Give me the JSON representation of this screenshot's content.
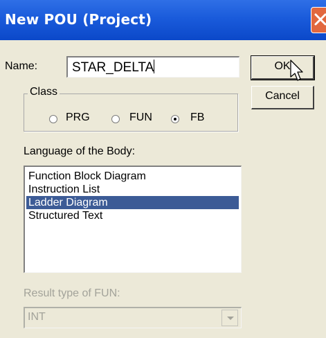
{
  "window": {
    "title": "New POU (Project)",
    "close_icon": "close-icon",
    "titlebar_color": "#0b48c9",
    "close_color": "#e2683e"
  },
  "name_field": {
    "label": "Name:",
    "value": "STAR_DELTA"
  },
  "buttons": {
    "ok": "OK",
    "cancel": "Cancel"
  },
  "class_group": {
    "label": "Class",
    "options": [
      {
        "label": "PRG",
        "checked": false
      },
      {
        "label": "FUN",
        "checked": false
      },
      {
        "label": "FB",
        "checked": true
      }
    ]
  },
  "language": {
    "label": "Language of the Body:",
    "items": [
      {
        "label": "Function Block Diagram",
        "selected": false
      },
      {
        "label": "Instruction List",
        "selected": false
      },
      {
        "label": "Ladder Diagram",
        "selected": true
      },
      {
        "label": "Structured Text",
        "selected": false
      }
    ],
    "selection_color": "#3c5b96"
  },
  "result_type": {
    "label": "Result type of FUN:",
    "value": "INT",
    "disabled": true
  },
  "cursor_icon": "mouse-pointer-icon"
}
